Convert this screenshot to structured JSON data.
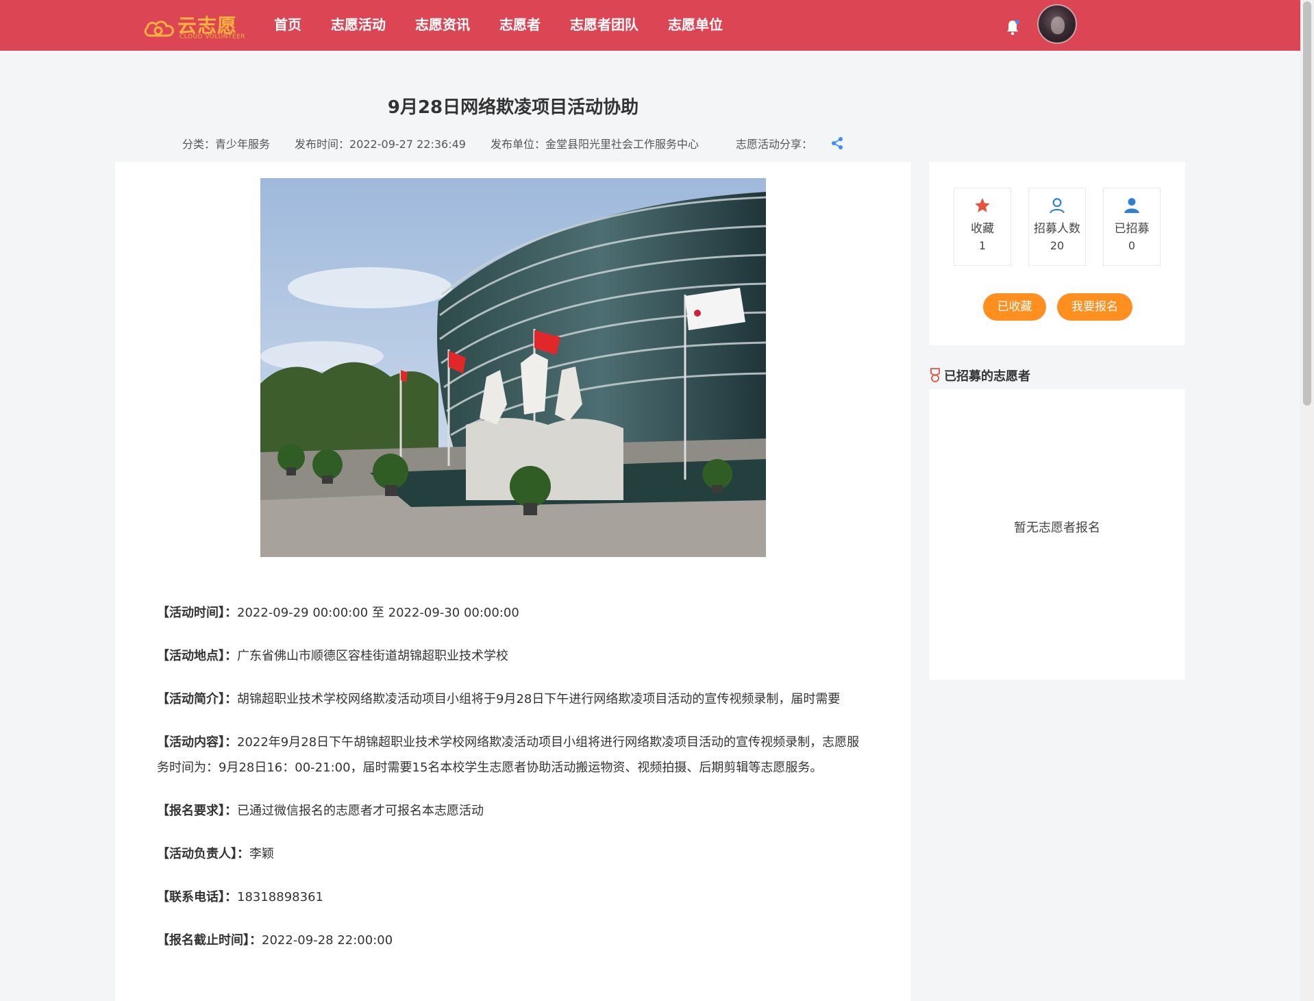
{
  "header": {
    "logo_cn": "云志愿",
    "logo_en": "CLOUD VOLUNTEER",
    "nav": [
      "首页",
      "志愿活动",
      "志愿资讯",
      "志愿者",
      "志愿者团队",
      "志愿单位"
    ]
  },
  "article": {
    "title": "9月28日网络欺凌项目活动协助",
    "category": "分类：青少年服务",
    "publish_time": "发布时间：2022-09-27 22:36:49",
    "publisher": "发布单位：金堂县阳光里社会工作服务中心",
    "share_label": "志愿活动分享："
  },
  "details": [
    {
      "label": "【活动时间】：",
      "value": "2022-09-29 00:00:00 至 2022-09-30 00:00:00"
    },
    {
      "label": "【活动地点】：",
      "value": "广东省佛山市顺德区容桂街道胡锦超职业技术学校"
    },
    {
      "label": "【活动简介】：",
      "value": "胡锦超职业技术学校网络欺凌活动项目小组将于9月28日下午进行网络欺凌项目活动的宣传视频录制，届时需要"
    },
    {
      "label": "【活动内容】：",
      "value": "2022年9月28日下午胡锦超职业技术学校网络欺凌活动项目小组将进行网络欺凌项目活动的宣传视频录制，志愿服务时间为：9月28日16：00-21:00，届时需要15名本校学生志愿者协助活动搬运物资、视频拍摄、后期剪辑等志愿服务。"
    },
    {
      "label": "【报名要求】：",
      "value": "已通过微信报名的志愿者才可报名本志愿活动"
    },
    {
      "label": "【活动负责人】：",
      "value": "李颖"
    },
    {
      "label": "【联系电话】：",
      "value": "18318898361"
    },
    {
      "label": "【报名截止时间】：",
      "value": "2022-09-28 22:00:00"
    }
  ],
  "stats": {
    "favorite_label": "收藏",
    "favorite_count": "1",
    "recruit_label": "招募人数",
    "recruit_count": "20",
    "recruited_label": "已招募",
    "recruited_count": "0"
  },
  "buttons": {
    "favorited": "已收藏",
    "signup": "我要报名"
  },
  "sidebar": {
    "recruited_title": "已招募的志愿者",
    "empty_text": "暂无志愿者报名"
  },
  "colors": {
    "header": "#dc4554",
    "accent": "#ff8f1f",
    "logo": "#ffb23e"
  }
}
